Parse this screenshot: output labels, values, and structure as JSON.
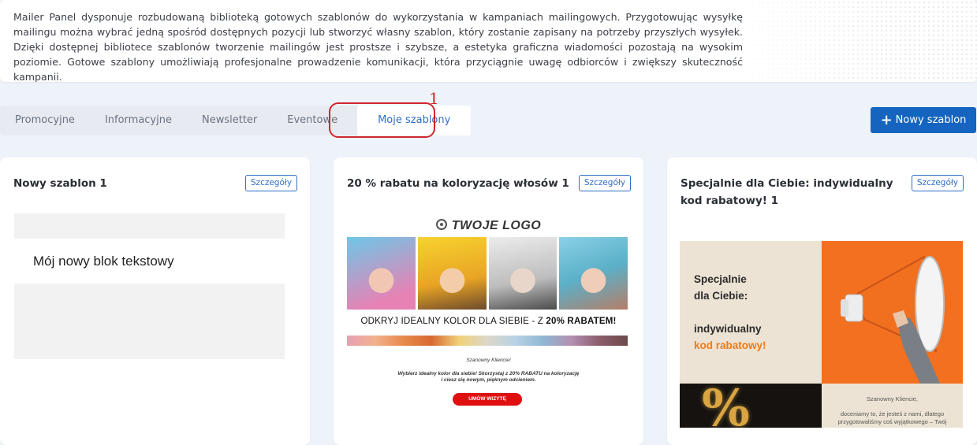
{
  "intro": {
    "text": "Mailer Panel dysponuje rozbudowaną biblioteką gotowych szablonów do wykorzystania w kampaniach mailingowych. Przygotowując wysyłkę mailingu można wybrać jedną spośród dostępnych pozycji lub stworzyć własny szablon, który zostanie zapisany na potrzeby przyszłych wysyłek. Dzięki dostępnej bibliotece szablonów tworzenie mailingów jest prostsze i szybsze, a estetyka graficzna wiadomości pozostają na wysokim poziomie. Gotowe szablony umożliwiają profesjonalne prowadzenie komunikacji, która przyciągnie uwagę odbiorców i zwiększy skuteczność kampanii."
  },
  "tabs": [
    {
      "label": "Promocyjne"
    },
    {
      "label": "Informacyjne"
    },
    {
      "label": "Newsletter"
    },
    {
      "label": "Eventowe"
    },
    {
      "label": "Moje szablony"
    }
  ],
  "annotation": {
    "marker": "1"
  },
  "toolbar": {
    "new_template_label": "Nowy szablon"
  },
  "colors": {
    "accent": "#1565c0",
    "highlight": "#d0262c"
  },
  "cards": [
    {
      "title": "Nowy szablon 1",
      "details_label": "Szczegóły",
      "preview": {
        "text_block": "Mój nowy blok tekstowy"
      }
    },
    {
      "title": "20 % rabatu na koloryzację włosów 1",
      "details_label": "Szczegóły",
      "preview": {
        "logo": "TWOJE LOGO",
        "headline_prefix": "ODKRYJ IDEALNY KOLOR DLA SIEBIE - Z ",
        "headline_bold": "20% RABATEM!",
        "greeting": "Szanowny Kliencie!",
        "body_line1": "Wybierz idealny kolor dla siebie! Skorzystaj z 20% RABATU na koloryzację",
        "body_line2": "i ciesz się nowym, pięknym odcieniem.",
        "cta": "UMÓW WIZYTĘ"
      }
    },
    {
      "title": "Specjalnie dla Ciebie: indywidualny kod rabatowy! 1",
      "details_label": "Szczegóły",
      "preview": {
        "line1": "Specjalnie",
        "line2": "dla Ciebie:",
        "line3": "indywidualny",
        "line4": "kod rabatowy!",
        "percent": "%",
        "greeting": "Szanowny Kliencie,",
        "body_line1": "doceniamy to, że jesteś z nami, dlatego",
        "body_line2": "przygotowaliśmy coś wyjątkowego – Twój"
      }
    }
  ]
}
